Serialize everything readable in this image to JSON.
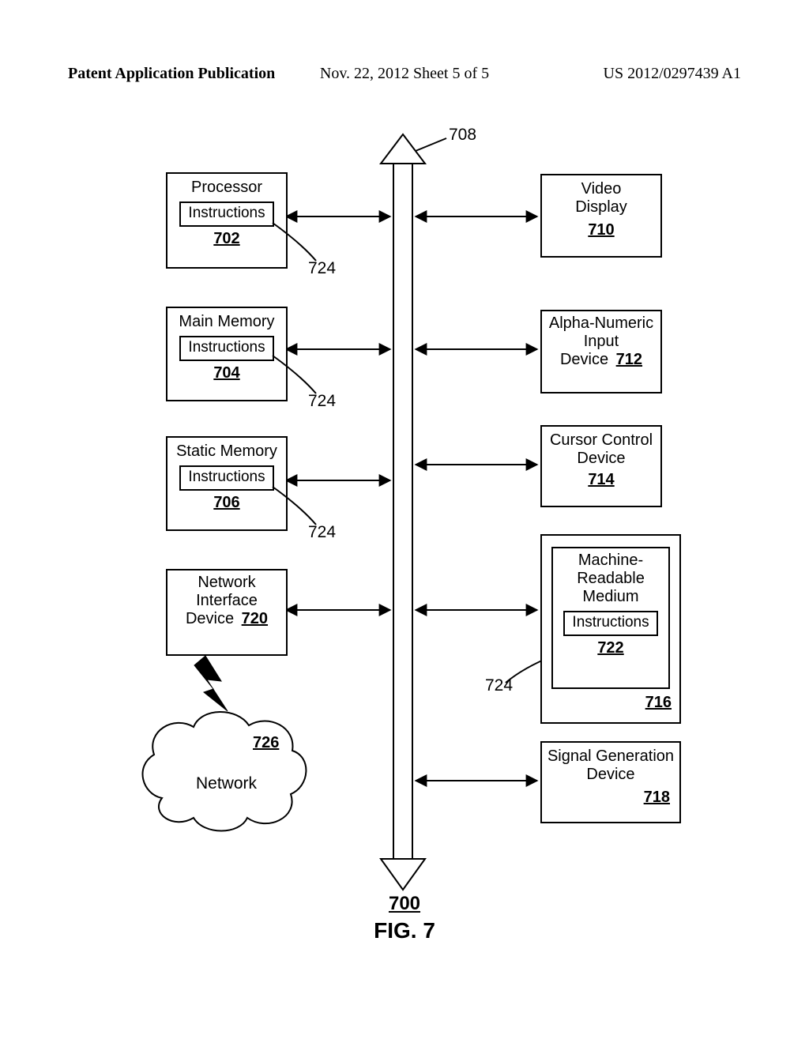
{
  "header": {
    "left": "Patent Application Publication",
    "mid": "Nov. 22, 2012  Sheet 5 of 5",
    "right": "US 2012/0297439 A1"
  },
  "labels": {
    "bus_ref": "708",
    "instr": "Instructions",
    "processor": {
      "title": "Processor",
      "ref": "702"
    },
    "mainmem": {
      "title": "Main Memory",
      "ref": "704"
    },
    "staticmem": {
      "title": "Static Memory",
      "ref": "706"
    },
    "netif": {
      "title1": "Network",
      "title2": "Interface",
      "title3": "Device",
      "ref": "720"
    },
    "video": {
      "title1": "Video",
      "title2": "Display",
      "ref": "710"
    },
    "alpha": {
      "title1": "Alpha-Numeric",
      "title2": "Input",
      "title3": "Device",
      "ref": "712"
    },
    "cursor": {
      "title1": "Cursor Control",
      "title2": "Device",
      "ref": "714"
    },
    "medium": {
      "title1": "Machine-",
      "title2": "Readable",
      "title3": "Medium",
      "ref": "722"
    },
    "drive": {
      "ref": "716"
    },
    "siggen": {
      "title1": "Signal Generation",
      "title2": "Device",
      "ref": "718"
    },
    "network": {
      "title": "Network",
      "ref": "726"
    },
    "c724": "724",
    "fig_ref": "700",
    "fig_label": "FIG. 7"
  }
}
